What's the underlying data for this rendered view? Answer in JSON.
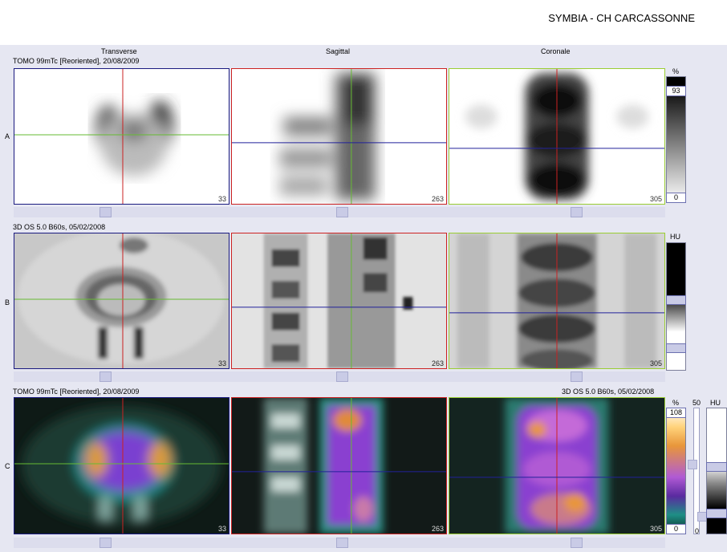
{
  "header": {
    "title": "SYMBIA - CH CARCASSONNE"
  },
  "columns": {
    "transverse": "Transverse",
    "sagittal": "Sagittal",
    "coronal": "Coronale"
  },
  "rows": {
    "a": {
      "label": "A",
      "series": "TOMO 99mTc [Reoriented], 20/08/2009"
    },
    "b": {
      "label": "B",
      "series": "3D  OS  5.0  B60s, 05/02/2008"
    },
    "c": {
      "label": "C",
      "series_left": "TOMO 99mTc [Reoriented], 20/08/2009",
      "series_right": "3D  OS  5.0  B60s, 05/02/2008"
    }
  },
  "slices": {
    "transverse": "33",
    "sagittal": "263",
    "coronal": "305"
  },
  "scales": {
    "a": {
      "unit": "%",
      "max": "93",
      "min": "0"
    },
    "b": {
      "unit": "HU"
    },
    "c": {
      "unit_pct": "%",
      "max": "108",
      "min": "0",
      "unit_hu": "HU",
      "mid": "50",
      "hu_min": "0"
    }
  },
  "colors": {
    "transverse_border": "#1a1a80",
    "sagittal_border": "#cc2222",
    "coronal_border": "#9acd32"
  }
}
